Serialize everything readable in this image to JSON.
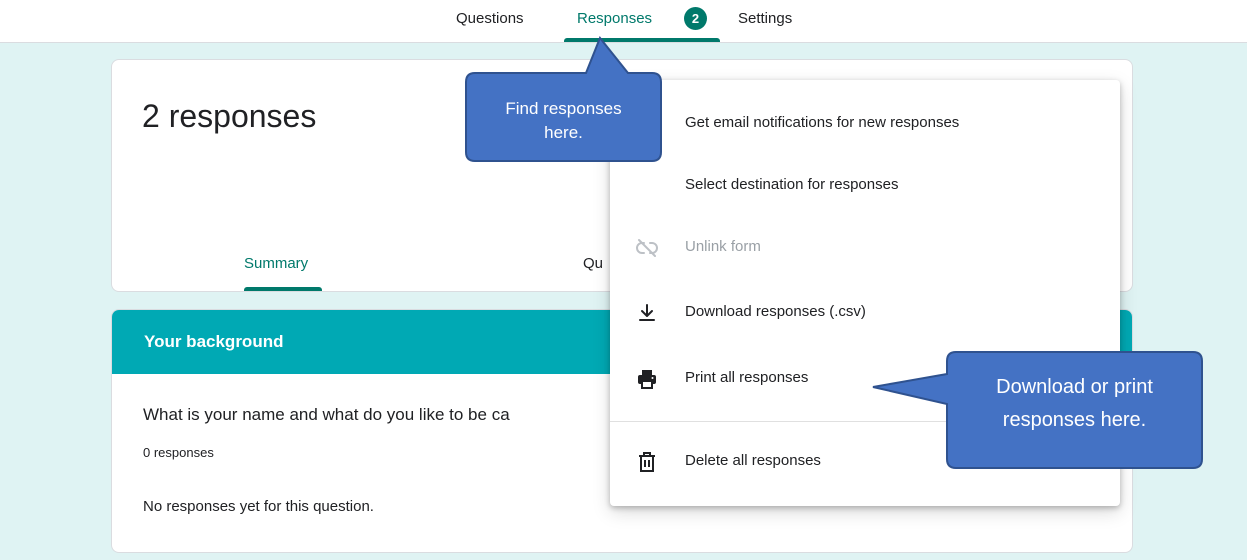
{
  "nav": {
    "tabs": [
      {
        "label": "Questions"
      },
      {
        "label": "Responses",
        "badge": "2"
      },
      {
        "label": "Settings"
      }
    ]
  },
  "summary": {
    "count_title": "2 responses",
    "tabs": [
      {
        "label": "Summary"
      },
      {
        "label": "Qu"
      }
    ]
  },
  "section": {
    "title": "Your background",
    "question": "What is your name and what do you like to be ca",
    "question_count": "0 responses",
    "empty_text": "No responses yet for this question."
  },
  "menu": {
    "items": [
      {
        "label": "Get email notifications for new responses",
        "icon": "none"
      },
      {
        "label": "Select destination for responses",
        "icon": "none"
      },
      {
        "label": "Unlink form",
        "icon": "unlink-icon",
        "disabled": true
      },
      {
        "label": "Download responses (.csv)",
        "icon": "download-icon"
      },
      {
        "label": "Print all responses",
        "icon": "print-icon"
      },
      {
        "label": "Delete all responses",
        "icon": "trash-icon"
      }
    ]
  },
  "callouts": {
    "find": {
      "line1": "Find responses",
      "line2": "here."
    },
    "download": {
      "line1": "Download or print",
      "line2": "responses here."
    }
  },
  "colors": {
    "accent": "#00796b",
    "section_header": "#00a9b4",
    "background": "#dff3f3",
    "callout_fill": "#4472c4",
    "callout_border": "#2f528f"
  }
}
